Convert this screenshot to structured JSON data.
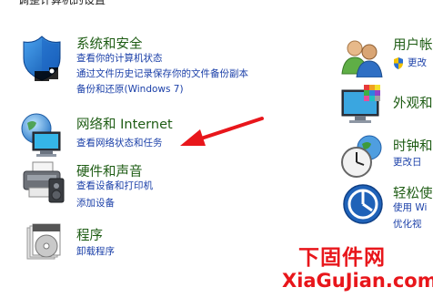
{
  "header": {
    "title": "调整计算机的设置"
  },
  "categories": {
    "security": {
      "title": "系统和安全",
      "links": [
        "查看你的计算机状态",
        "通过文件历史记录保存你的文件备份副本",
        "备份和还原(Windows 7)"
      ]
    },
    "network": {
      "title": "网络和 Internet",
      "links": [
        "查看网络状态和任务"
      ]
    },
    "hardware": {
      "title": "硬件和声音",
      "links": [
        "查看设备和打印机",
        "添加设备"
      ]
    },
    "programs": {
      "title": "程序",
      "links": [
        "卸载程序"
      ]
    },
    "users": {
      "title": "用户帐",
      "links": [
        "更改"
      ]
    },
    "appearance": {
      "title": "外观和"
    },
    "clock": {
      "title": "时钟和",
      "links": [
        "更改日"
      ]
    },
    "ease": {
      "title": "轻松使",
      "links": [
        "使用 Wi",
        "优化视"
      ]
    }
  },
  "watermark": {
    "chinese": "下固件网",
    "url": "XiaGuJian.com"
  },
  "colors": {
    "category_title": "#1e5c14",
    "link": "#1a3fa8",
    "arrow": "#e8161b",
    "watermark": "#e8161b"
  },
  "icons": {
    "security": "shield-icon",
    "network": "globe-monitor-icon",
    "hardware": "printer-speaker-icon",
    "programs": "software-disc-icon",
    "users": "users-icon",
    "appearance": "monitor-palette-icon",
    "clock": "clock-globe-icon",
    "ease": "ease-of-access-icon",
    "uac": "uac-shield-icon"
  }
}
